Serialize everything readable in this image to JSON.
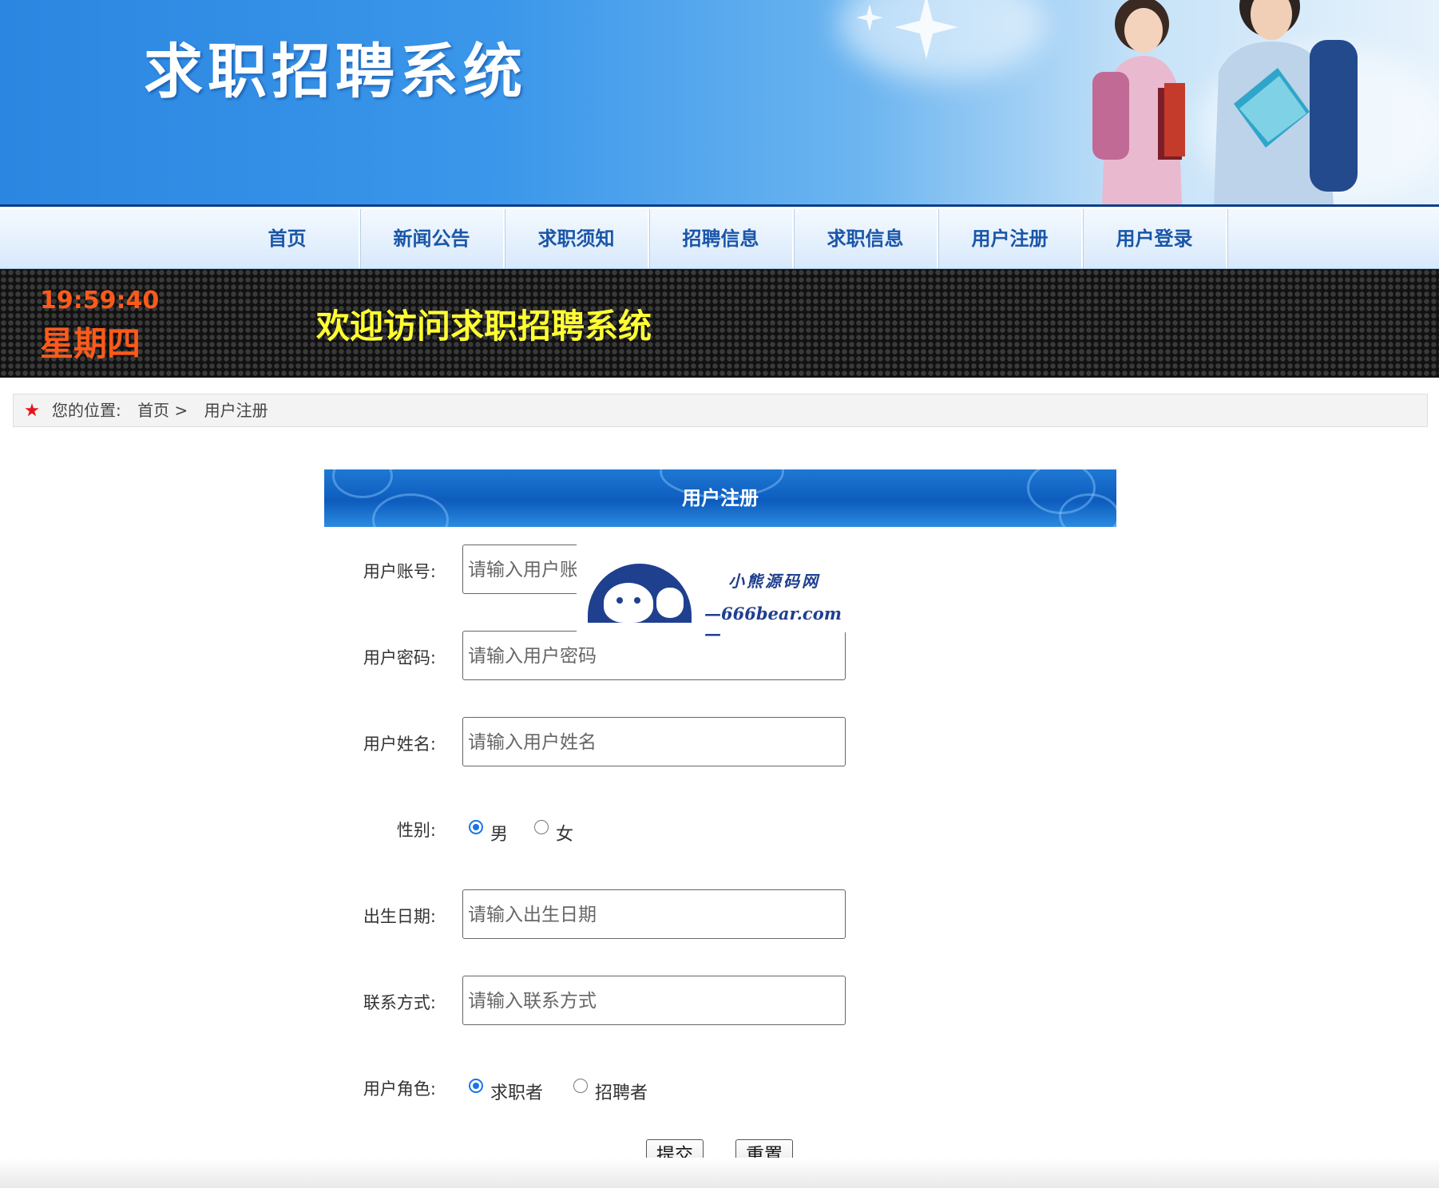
{
  "header": {
    "title": "求职招聘系统"
  },
  "nav": {
    "items": [
      {
        "label": "首页"
      },
      {
        "label": "新闻公告"
      },
      {
        "label": "求职须知"
      },
      {
        "label": "招聘信息"
      },
      {
        "label": "求职信息"
      },
      {
        "label": "用户注册"
      },
      {
        "label": "用户登录"
      }
    ]
  },
  "led": {
    "time": "19:59:40",
    "weekday": "星期四",
    "welcome": "欢迎访问求职招聘系统"
  },
  "breadcrumb": {
    "prefix": "您的位置:",
    "home": "首页 >",
    "current": "用户注册"
  },
  "form": {
    "title": "用户注册",
    "account": {
      "label": "用户账号:",
      "placeholder": "请输入用户账"
    },
    "password": {
      "label": "用户密码:",
      "placeholder": "请输入用户密码"
    },
    "name": {
      "label": "用户姓名:",
      "placeholder": "请输入用户姓名"
    },
    "gender": {
      "label": "性别:",
      "options": [
        "男",
        "女"
      ],
      "selected": "男"
    },
    "birthday": {
      "label": "出生日期:",
      "placeholder": "请输入出生日期"
    },
    "contact": {
      "label": "联系方式:",
      "placeholder": "请输入联系方式"
    },
    "role": {
      "label": "用户角色:",
      "options": [
        "求职者",
        "招聘者"
      ],
      "selected": "求职者"
    },
    "submit_label": "提交",
    "reset_label": "重置"
  },
  "watermark": {
    "name": "小熊源码网",
    "url": "—666bear.com—"
  },
  "colors": {
    "nav_text": "#1a56a8",
    "led_time": "#ff5a1a",
    "led_welcome": "#ffff33",
    "panel_head": "#0d5cbd"
  }
}
